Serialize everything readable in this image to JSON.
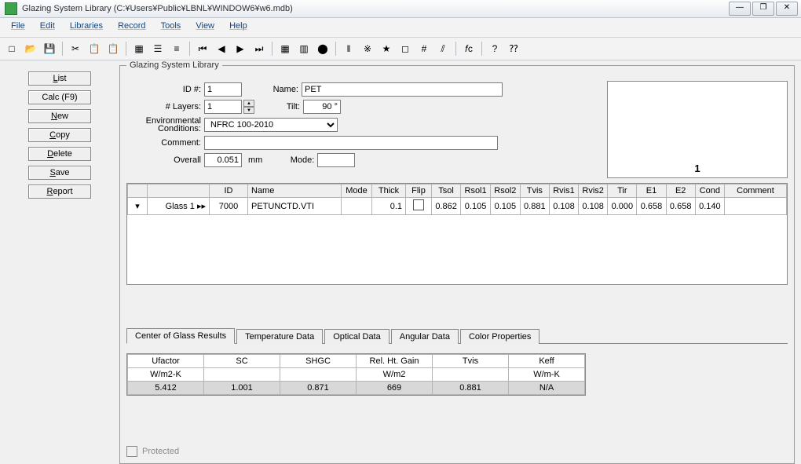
{
  "window": {
    "title": "Glazing System Library (C:¥Users¥Public¥LBNL¥WINDOW6¥w6.mdb)",
    "min_icon": "—",
    "restore_icon": "❐",
    "close_icon": "✕"
  },
  "menubar": [
    "File",
    "Edit",
    "Libraries",
    "Record",
    "Tools",
    "View",
    "Help"
  ],
  "toolbar_icons": [
    "□",
    "📂",
    "💾",
    "|",
    "✂",
    "📋",
    "📋",
    "|",
    "▦",
    "☰",
    "≡",
    "|",
    "⏮",
    "◀",
    "▶",
    "⏭",
    "|",
    "▦",
    "▥",
    "⬤",
    "|",
    "‖",
    "※",
    "★",
    "◻",
    "#",
    "⫽",
    "|",
    "𝑓c",
    "|",
    "?",
    "⁇"
  ],
  "side_buttons": {
    "list": "List",
    "calc": "Calc (F9)",
    "new": "New",
    "copy": "Copy",
    "delete": "Delete",
    "save": "Save",
    "report": "Report"
  },
  "legend": "Glazing System Library",
  "form": {
    "id_label": "ID #:",
    "id_value": "1",
    "name_label": "Name:",
    "name_value": "PET",
    "layers_label": "# Layers:",
    "layers_value": "1",
    "tilt_label": "Tilt:",
    "tilt_value": "90 °",
    "env_label_l1": "Environmental",
    "env_label_l2": "Conditions:",
    "env_value": "NFRC 100-2010",
    "comment_label": "Comment:",
    "comment_value": "",
    "overall_label": "Overall",
    "overall_value": "0.051",
    "overall_unit": "mm",
    "mode_label": "Mode:",
    "mode_value": ""
  },
  "preview_caption": "1",
  "layer_table": {
    "headers": [
      "",
      "",
      "ID",
      "Name",
      "Mode",
      "Thick",
      "Flip",
      "Tsol",
      "Rsol1",
      "Rsol2",
      "Tvis",
      "Rvis1",
      "Rvis2",
      "Tir",
      "E1",
      "E2",
      "Cond",
      "Comment"
    ],
    "row": {
      "label": "Glass 1 ▸▸",
      "id": "7000",
      "name": "PETUNCTD.VTI",
      "mode": "",
      "thick": "0.1",
      "tsol": "0.862",
      "rsol1": "0.105",
      "rsol2": "0.105",
      "tvis": "0.881",
      "rvis1": "0.108",
      "rvis2": "0.108",
      "tir": "0.000",
      "e1": "0.658",
      "e2": "0.658",
      "cond": "0.140",
      "comment": ""
    }
  },
  "tabs": [
    "Center of Glass Results",
    "Temperature Data",
    "Optical Data",
    "Angular Data",
    "Color Properties"
  ],
  "results": {
    "headers": [
      "Ufactor",
      "SC",
      "SHGC",
      "Rel. Ht. Gain",
      "Tvis",
      "Keff"
    ],
    "units": [
      "W/m2-K",
      "",
      "",
      "W/m2",
      "",
      "W/m-K"
    ],
    "values": [
      "5.412",
      "1.001",
      "0.871",
      "669",
      "0.881",
      "N/A"
    ]
  },
  "protected_label": "Protected"
}
